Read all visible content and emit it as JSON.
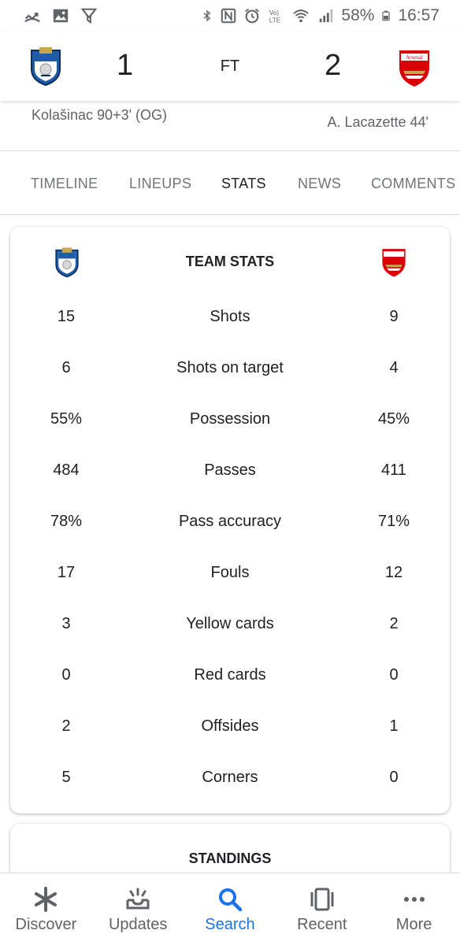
{
  "status_bar": {
    "battery": "58%",
    "time": "16:57",
    "icons_left": [
      "missed-call-icon",
      "image-icon",
      "download-icon"
    ],
    "icons_right": [
      "bluetooth-icon",
      "nfc-icon",
      "alarm-icon",
      "volte-icon",
      "wifi-icon",
      "signal-icon",
      "battery-icon"
    ]
  },
  "match": {
    "home_score": "1",
    "away_score": "2",
    "status": "FT",
    "home_scorer": "Kolašinac 90+3' (OG)",
    "away_scorer": "A. Lacazette 44'",
    "away_crest_text": "Arsenal",
    "colors": {
      "away_red": "#db0007",
      "home_blue": "#1e5ca8"
    }
  },
  "tabs": [
    "TIMELINE",
    "LINEUPS",
    "STATS",
    "NEWS",
    "COMMENTS"
  ],
  "active_tab": "STATS",
  "team_stats": {
    "title": "TEAM STATS",
    "rows": [
      {
        "label": "Shots",
        "home": "15",
        "away": "9"
      },
      {
        "label": "Shots on target",
        "home": "6",
        "away": "4"
      },
      {
        "label": "Possession",
        "home": "55%",
        "away": "45%"
      },
      {
        "label": "Passes",
        "home": "484",
        "away": "411"
      },
      {
        "label": "Pass accuracy",
        "home": "78%",
        "away": "71%"
      },
      {
        "label": "Fouls",
        "home": "17",
        "away": "12"
      },
      {
        "label": "Yellow cards",
        "home": "3",
        "away": "2"
      },
      {
        "label": "Red cards",
        "home": "0",
        "away": "0"
      },
      {
        "label": "Offsides",
        "home": "2",
        "away": "1"
      },
      {
        "label": "Corners",
        "home": "5",
        "away": "0"
      }
    ]
  },
  "standings": {
    "title": "STANDINGS"
  },
  "bottom_nav": [
    {
      "label": "Discover",
      "icon": "asterisk-icon"
    },
    {
      "label": "Updates",
      "icon": "updates-icon"
    },
    {
      "label": "Search",
      "icon": "search-icon"
    },
    {
      "label": "Recent",
      "icon": "recent-icon"
    },
    {
      "label": "More",
      "icon": "more-dots-icon"
    }
  ],
  "active_nav": "Search",
  "accent_color": "#1a73e8"
}
